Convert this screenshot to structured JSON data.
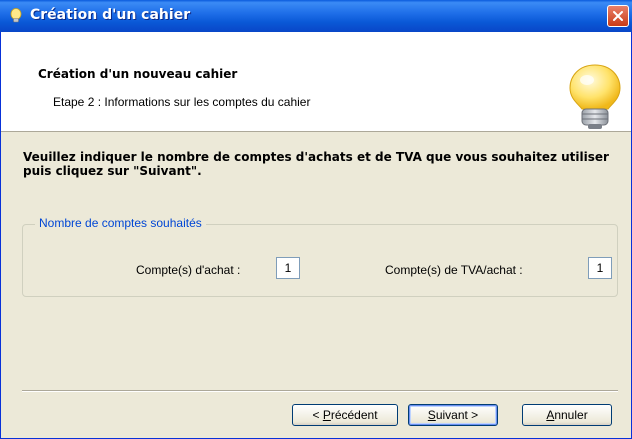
{
  "window": {
    "title": "Création d'un cahier",
    "close_icon": "close-icon",
    "title_icon": "lightbulb-icon"
  },
  "header": {
    "title": "Création d'un nouveau cahier",
    "subtitle": "Etape 2 : Informations sur les comptes du cahier",
    "icon": "lightbulb-icon"
  },
  "instruction": "Veuillez indiquer le nombre de comptes d'achats et de TVA que vous souhaitez utiliser puis cliquez sur \"Suivant\".",
  "group": {
    "legend": "Nombre de comptes souhaités",
    "purchase_label": "Compte(s) d'achat :",
    "purchase_value": "1",
    "vat_label": "Compte(s) de TVA/achat :",
    "vat_value": "1"
  },
  "buttons": {
    "previous": {
      "prefix": "< ",
      "mnemonic": "P",
      "rest": "récédent"
    },
    "next": {
      "mnemonic": "S",
      "rest": "uivant >"
    },
    "cancel": {
      "mnemonic": "A",
      "rest": "nnuler"
    }
  },
  "colors": {
    "title_bar": "#0a58d6",
    "dialog_bg": "#ece9d8",
    "legend_text": "#0046d5",
    "close_button": "#c93b17"
  }
}
